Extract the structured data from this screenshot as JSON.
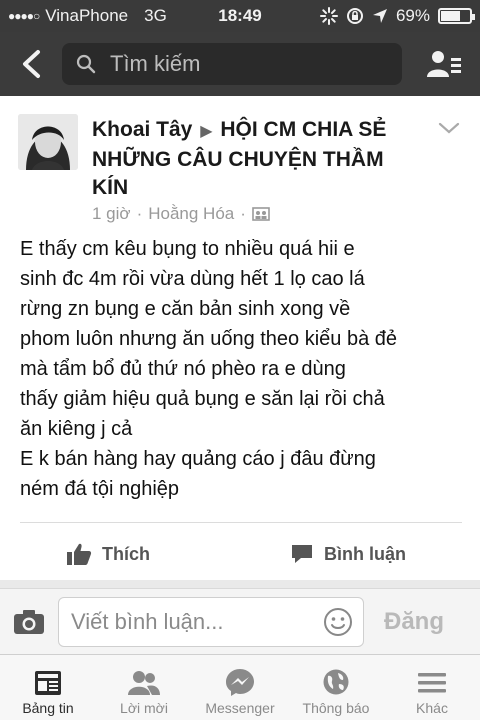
{
  "status_bar": {
    "carrier": "VinaPhone",
    "network": "3G",
    "time": "18:49",
    "battery_percent_label": "69%",
    "battery_level": 0.69
  },
  "nav": {
    "search_placeholder": "Tìm kiếm"
  },
  "post": {
    "author": "Khoai Tây",
    "group": "HỘI CM CHIA SẺ NHỮNG CÂU CHUYỆN THẦM KÍN",
    "time": "1 giờ",
    "location": "Hoằng Hóa",
    "body_lines": [
      "E thấy cm kêu bụng to nhiều quá hii e",
      "sinh đc 4m rồi vừa dùng hết 1 lọ cao lá",
      "rừng zn  bụng e căn bản sinh xong về",
      "phom luôn nhưng ăn uống theo kiểu bà đẻ",
      "mà tẩm bổ đủ thứ nó phèo ra e dùng",
      "thấy giảm hiệu quả bụng e săn lại rồi chả",
      "ăn kiêng j cả",
      "E k bán hàng hay quảng cáo j đâu đừng",
      "ném đá tội nghiệp"
    ],
    "like_label": "Thích",
    "comment_label": "Bình luận"
  },
  "composer": {
    "placeholder": "Viết bình luận...",
    "post_label": "Đăng"
  },
  "tabs": {
    "news_feed": "Bảng tin",
    "requests": "Lời mời",
    "messenger": "Messenger",
    "notifications": "Thông báo",
    "more": "Khác"
  },
  "colors": {
    "bars": "#3b3b3b",
    "accent_muted": "#8a8a8a"
  }
}
